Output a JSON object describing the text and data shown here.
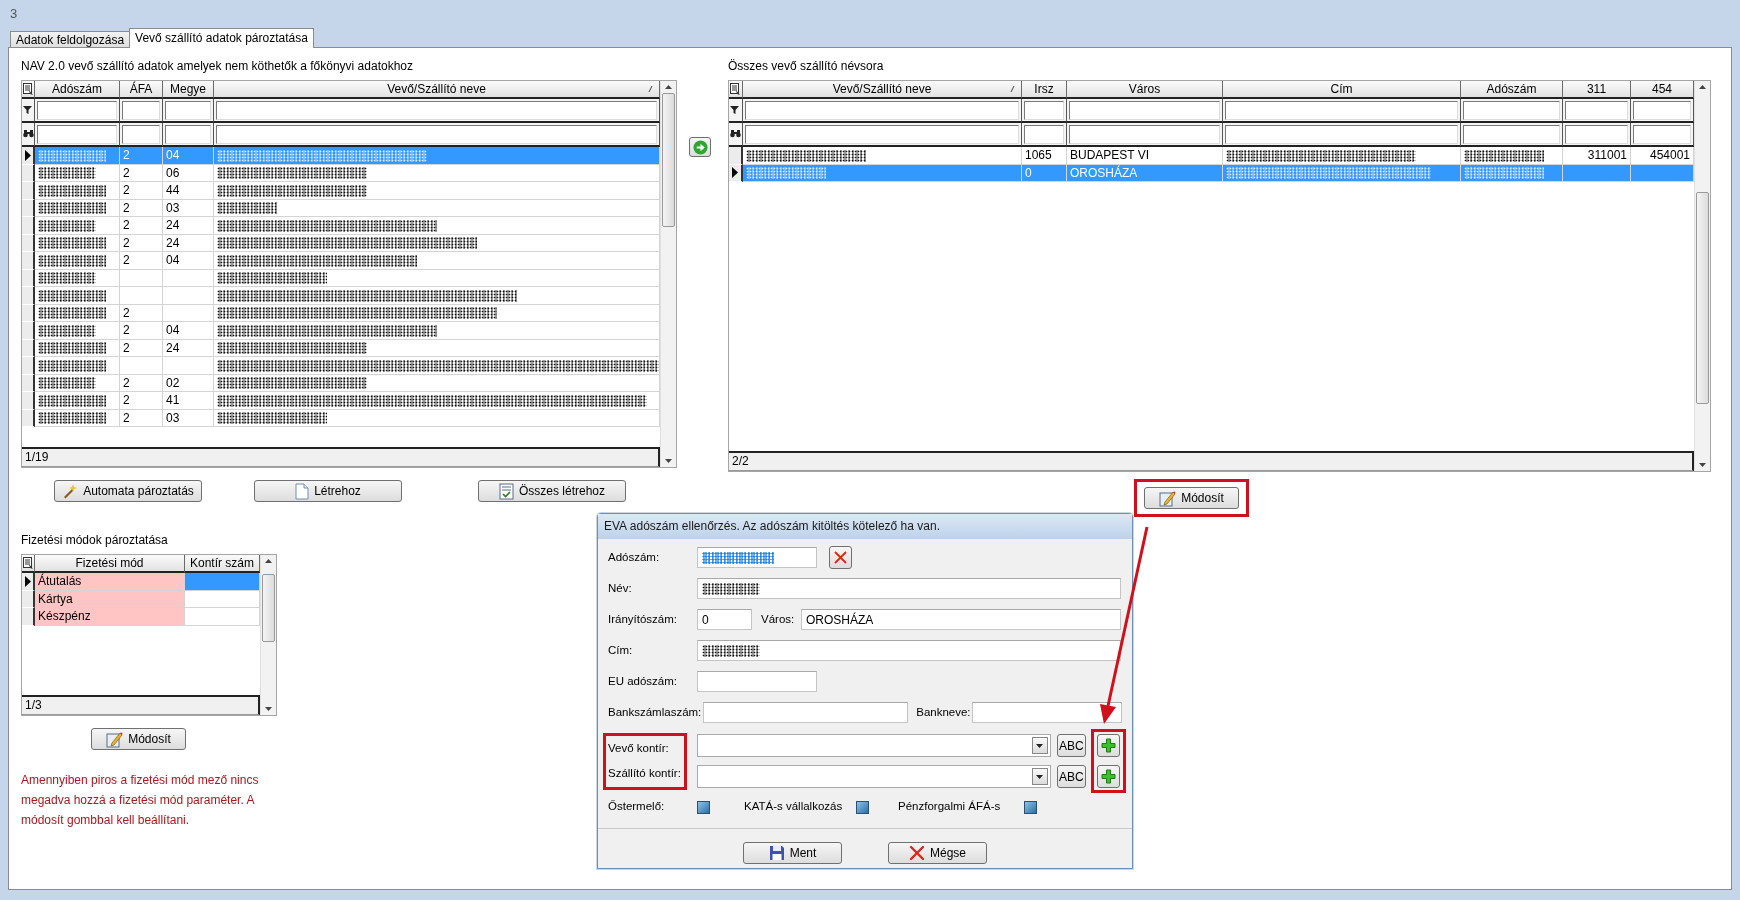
{
  "window": {
    "title": "3"
  },
  "tabs": [
    {
      "label": "Adatok feldolgozása",
      "selected": false
    },
    {
      "label": "Vevő szállító adatok pároztatása",
      "selected": true
    }
  ],
  "nav_grid": {
    "caption": "NAV 2.0 vevő szállító adatok amelyek nem köthetők a főkönyvi adatokhoz",
    "columns": [
      {
        "label": "Adószám",
        "sorted": false
      },
      {
        "label": "ÁFA",
        "sorted": false
      },
      {
        "label": "Megye",
        "sorted": false
      },
      {
        "label": "Vevő/Szállító neve",
        "sorted": true
      }
    ],
    "rows": [
      {
        "selected": true,
        "cells": [
          {
            "redacted": true
          },
          {
            "redacted": false,
            "text": "2"
          },
          {
            "redacted": false,
            "text": "04"
          },
          {
            "redacted": true
          }
        ]
      },
      {
        "selected": false,
        "cells": [
          {
            "redacted": true
          },
          {
            "redacted": false,
            "text": "2"
          },
          {
            "redacted": false,
            "text": "06"
          },
          {
            "redacted": true
          }
        ]
      },
      {
        "selected": false,
        "cells": [
          {
            "redacted": true
          },
          {
            "redacted": false,
            "text": "2"
          },
          {
            "redacted": false,
            "text": "44"
          },
          {
            "redacted": true
          }
        ]
      },
      {
        "selected": false,
        "cells": [
          {
            "redacted": true
          },
          {
            "redacted": false,
            "text": "2"
          },
          {
            "redacted": false,
            "text": "03"
          },
          {
            "redacted": true
          }
        ]
      },
      {
        "selected": false,
        "cells": [
          {
            "redacted": true
          },
          {
            "redacted": false,
            "text": "2"
          },
          {
            "redacted": false,
            "text": "24"
          },
          {
            "redacted": true
          }
        ]
      },
      {
        "selected": false,
        "cells": [
          {
            "redacted": true
          },
          {
            "redacted": false,
            "text": "2"
          },
          {
            "redacted": false,
            "text": "24"
          },
          {
            "redacted": true
          }
        ]
      },
      {
        "selected": false,
        "cells": [
          {
            "redacted": true
          },
          {
            "redacted": false,
            "text": "2"
          },
          {
            "redacted": false,
            "text": "04"
          },
          {
            "redacted": true
          }
        ]
      },
      {
        "selected": false,
        "cells": [
          {
            "redacted": true
          },
          {
            "redacted": false
          },
          {
            "redacted": false
          },
          {
            "redacted": true
          }
        ]
      },
      {
        "selected": false,
        "cells": [
          {
            "redacted": true
          },
          {
            "redacted": false
          },
          {
            "redacted": false
          },
          {
            "redacted": true
          }
        ]
      },
      {
        "selected": false,
        "cells": [
          {
            "redacted": true
          },
          {
            "redacted": false,
            "text": "2"
          },
          {
            "redacted": false
          },
          {
            "redacted": true
          }
        ]
      },
      {
        "selected": false,
        "cells": [
          {
            "redacted": true
          },
          {
            "redacted": false,
            "text": "2"
          },
          {
            "redacted": false,
            "text": "04"
          },
          {
            "redacted": true
          }
        ]
      },
      {
        "selected": false,
        "cells": [
          {
            "redacted": true
          },
          {
            "redacted": false,
            "text": "2"
          },
          {
            "redacted": false,
            "text": "24"
          },
          {
            "redacted": true
          }
        ]
      },
      {
        "selected": false,
        "cells": [
          {
            "redacted": true
          },
          {
            "redacted": false
          },
          {
            "redacted": false
          },
          {
            "redacted": true
          }
        ]
      },
      {
        "selected": false,
        "cells": [
          {
            "redacted": true
          },
          {
            "redacted": false,
            "text": "2"
          },
          {
            "redacted": false,
            "text": "02"
          },
          {
            "redacted": true
          }
        ]
      },
      {
        "selected": false,
        "cells": [
          {
            "redacted": true
          },
          {
            "redacted": false,
            "text": "2"
          },
          {
            "redacted": false,
            "text": "41"
          },
          {
            "redacted": true
          }
        ]
      },
      {
        "selected": false,
        "cells": [
          {
            "redacted": true
          },
          {
            "redacted": false,
            "text": "2"
          },
          {
            "redacted": false,
            "text": "03"
          },
          {
            "redacted": true
          }
        ]
      }
    ],
    "footer": "1/19"
  },
  "nav_buttons": [
    {
      "label": "Automata pároztatás"
    },
    {
      "label": "Létrehoz"
    },
    {
      "label": "Összes létrehoz"
    }
  ],
  "all_grid": {
    "caption": "Összes vevő szállító névsora",
    "columns": [
      {
        "label": "Vevő/Szállító neve",
        "sorted": true
      },
      {
        "label": "Irsz",
        "sorted": false
      },
      {
        "label": "Város",
        "sorted": false
      },
      {
        "label": "Cím",
        "sorted": false
      },
      {
        "label": "Adószám",
        "sorted": false
      },
      {
        "label": "311",
        "sorted": false
      },
      {
        "label": "454",
        "sorted": false
      }
    ],
    "rows": [
      {
        "selected": false,
        "cells": [
          {
            "redacted": true
          },
          {
            "redacted": false,
            "text": "1065"
          },
          {
            "redacted": false,
            "text": "BUDAPEST VI"
          },
          {
            "redacted": true
          },
          {
            "redacted": true
          },
          {
            "redacted": false,
            "text": "311001"
          },
          {
            "redacted": false,
            "text": "454001"
          }
        ]
      },
      {
        "selected": true,
        "cells": [
          {
            "redacted": true
          },
          {
            "redacted": false,
            "text": "0"
          },
          {
            "redacted": false,
            "text": "OROSHÁZA"
          },
          {
            "redacted": true
          },
          {
            "redacted": true
          },
          {
            "redacted": false
          },
          {
            "redacted": false
          }
        ]
      }
    ],
    "footer": "2/2"
  },
  "modify_button": {
    "label": "Módosít",
    "highlighted": true
  },
  "payment_grid": {
    "caption": "Fizetési módok pároztatása",
    "columns": [
      {
        "label": "Fizetési mód",
        "sorted": false
      },
      {
        "label": "Kontír szám",
        "sorted": false
      }
    ],
    "rows": [
      {
        "selected": true,
        "cells": [
          {
            "redacted": false,
            "missing": true,
            "text": "Átutalás"
          },
          {
            "redacted": false,
            "missing": false
          }
        ]
      },
      {
        "selected": false,
        "cells": [
          {
            "redacted": false,
            "missing": true,
            "text": "Kártya"
          },
          {
            "redacted": false,
            "missing": false
          }
        ]
      },
      {
        "selected": false,
        "cells": [
          {
            "redacted": false,
            "missing": true,
            "text": "Készpénz"
          },
          {
            "redacted": false,
            "missing": false
          }
        ]
      }
    ],
    "footer": "1/3"
  },
  "payment_modify_button": {
    "label": "Módosít",
    "highlighted": false
  },
  "payment_note": "Amennyiben piros a fizetési mód mező nincs megadva hozzá a fizetési mód paraméter. A módosít gombbal kell beállítani.",
  "dialog": {
    "title": "EVA adószám ellenőrzés. Az adószám kitöltés kötelező ha van.",
    "adoszam": {
      "label": "Adószám:",
      "redacted": true,
      "text_selected": true
    },
    "nev": {
      "label": "Név:",
      "redacted": true
    },
    "iranyitoszam": {
      "label": "Irányítószám:",
      "value": "0"
    },
    "varos": {
      "label": "Város:",
      "value": "OROSHÁZA"
    },
    "cim": {
      "label": "Cím:",
      "redacted": true
    },
    "eu_adoszam": {
      "label": "EU adószám:"
    },
    "bankszamlaszam": {
      "label": "Bankszámlaszám:"
    },
    "bankneve": {
      "label": "Bankneve:"
    },
    "kontir_rows": [
      {
        "label": "Vevő kontír:",
        "abc": "ABC"
      },
      {
        "label": "Szállító kontír:",
        "abc": "ABC"
      }
    ],
    "kontir_labels_highlighted": true,
    "add_buttons_highlighted": true,
    "checkboxes": [
      {
        "label": "Őstermelő:",
        "checked": false
      },
      {
        "label": "KATÁ-s vállalkozás",
        "checked": false
      },
      {
        "label": "Pénzforgalmi ÁFÁ-s",
        "checked": false
      }
    ],
    "buttons": [
      {
        "label": "Ment"
      },
      {
        "label": "Mégse"
      }
    ]
  },
  "annotations": [
    {
      "kind": "arrow"
    }
  ]
}
